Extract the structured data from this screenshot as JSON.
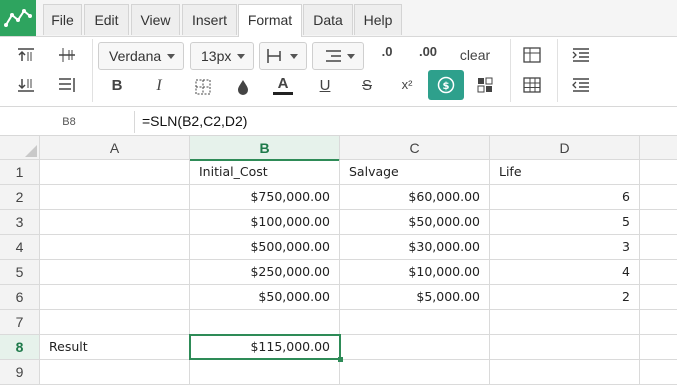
{
  "menu": {
    "tabs": [
      "File",
      "Edit",
      "View",
      "Insert",
      "Format",
      "Data",
      "Help"
    ],
    "active": "Format"
  },
  "toolbar": {
    "font_family": "Verdana",
    "font_size": "13px",
    "clear_label": "clear",
    "bold_label": "B",
    "italic_label": "I",
    "strike_label": "S",
    "underline_label": "U",
    "text_color_label": "A",
    "superscript_label": "x²",
    "decimal_decrease_label": ".0",
    "decimal_increase_label": ".00",
    "accent_color": "#2ea08c"
  },
  "formula_bar": {
    "cell_ref": "B8",
    "formula": "=SLN(B2,C2,D2)"
  },
  "sheet": {
    "columns": [
      "A",
      "B",
      "C",
      "D"
    ],
    "active_column": "B",
    "active_row": "8",
    "rows": [
      {
        "num": "1",
        "a": "",
        "b": "Initial_Cost",
        "c": "Salvage",
        "d": "Life"
      },
      {
        "num": "2",
        "a": "",
        "b": "$750,000.00",
        "c": "$60,000.00",
        "d": "6"
      },
      {
        "num": "3",
        "a": "",
        "b": "$100,000.00",
        "c": "$50,000.00",
        "d": "5"
      },
      {
        "num": "4",
        "a": "",
        "b": "$500,000.00",
        "c": "$30,000.00",
        "d": "3"
      },
      {
        "num": "5",
        "a": "",
        "b": "$250,000.00",
        "c": "$10,000.00",
        "d": "4"
      },
      {
        "num": "6",
        "a": "",
        "b": "$50,000.00",
        "c": "$5,000.00",
        "d": "2"
      },
      {
        "num": "7",
        "a": "",
        "b": "",
        "c": "",
        "d": ""
      },
      {
        "num": "8",
        "a": "Result",
        "b": "$115,000.00",
        "c": "",
        "d": ""
      },
      {
        "num": "9",
        "a": "",
        "b": "",
        "c": "",
        "d": ""
      }
    ]
  }
}
